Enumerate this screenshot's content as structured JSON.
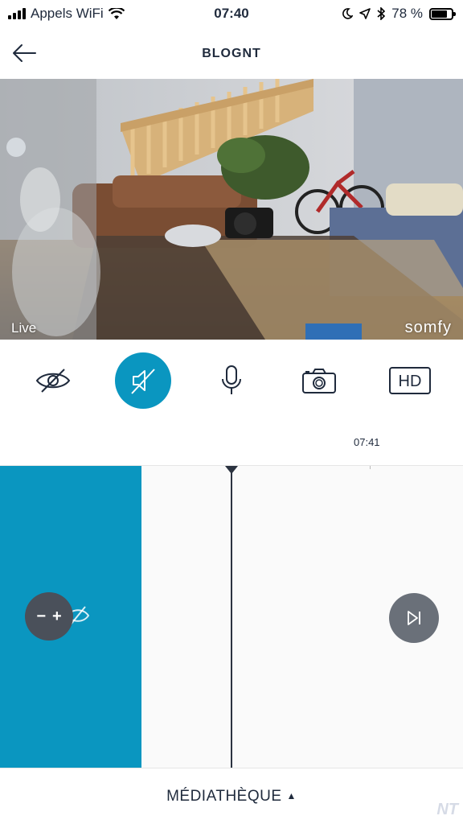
{
  "status_bar": {
    "carrier": "Appels WiFi",
    "time": "07:40",
    "battery": "78 %",
    "battery_level": 0.78
  },
  "header": {
    "title": "BLOGNT"
  },
  "video": {
    "live_label": "Live",
    "brand": "somfy"
  },
  "controls": {
    "items": [
      {
        "icon": "eye-slash-icon",
        "active": false
      },
      {
        "icon": "speaker-muted-icon",
        "active": true
      },
      {
        "icon": "microphone-icon",
        "active": false
      },
      {
        "icon": "camera-icon",
        "active": false
      },
      {
        "icon": "hd-icon",
        "label": "HD",
        "active": false
      }
    ]
  },
  "timeline": {
    "time_label": "07:41",
    "zoom_out": "−",
    "zoom_in": "+"
  },
  "bottom": {
    "media_label": "MÉDIATHÈQUE",
    "arrow": "▲",
    "watermark": "NT"
  },
  "colors": {
    "accent": "#0a96c0",
    "dark": "#1f2a3c",
    "timeline_bg": "#fafafa"
  }
}
